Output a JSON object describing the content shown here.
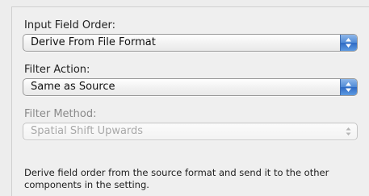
{
  "input_field_order": {
    "label": "Input Field Order:",
    "value": "Derive From File Format"
  },
  "filter_action": {
    "label": "Filter Action:",
    "value": "Same as Source"
  },
  "filter_method": {
    "label": "Filter Method:",
    "value": "Spatial Shift Upwards",
    "enabled": false
  },
  "description": "Derive field order from the source format and send it to the other components in the setting.",
  "colors": {
    "stepper_blue": "#4f8ad6",
    "disabled_text": "#a9a9a9"
  },
  "icons": {
    "stepper": "up-down-arrows-icon"
  }
}
